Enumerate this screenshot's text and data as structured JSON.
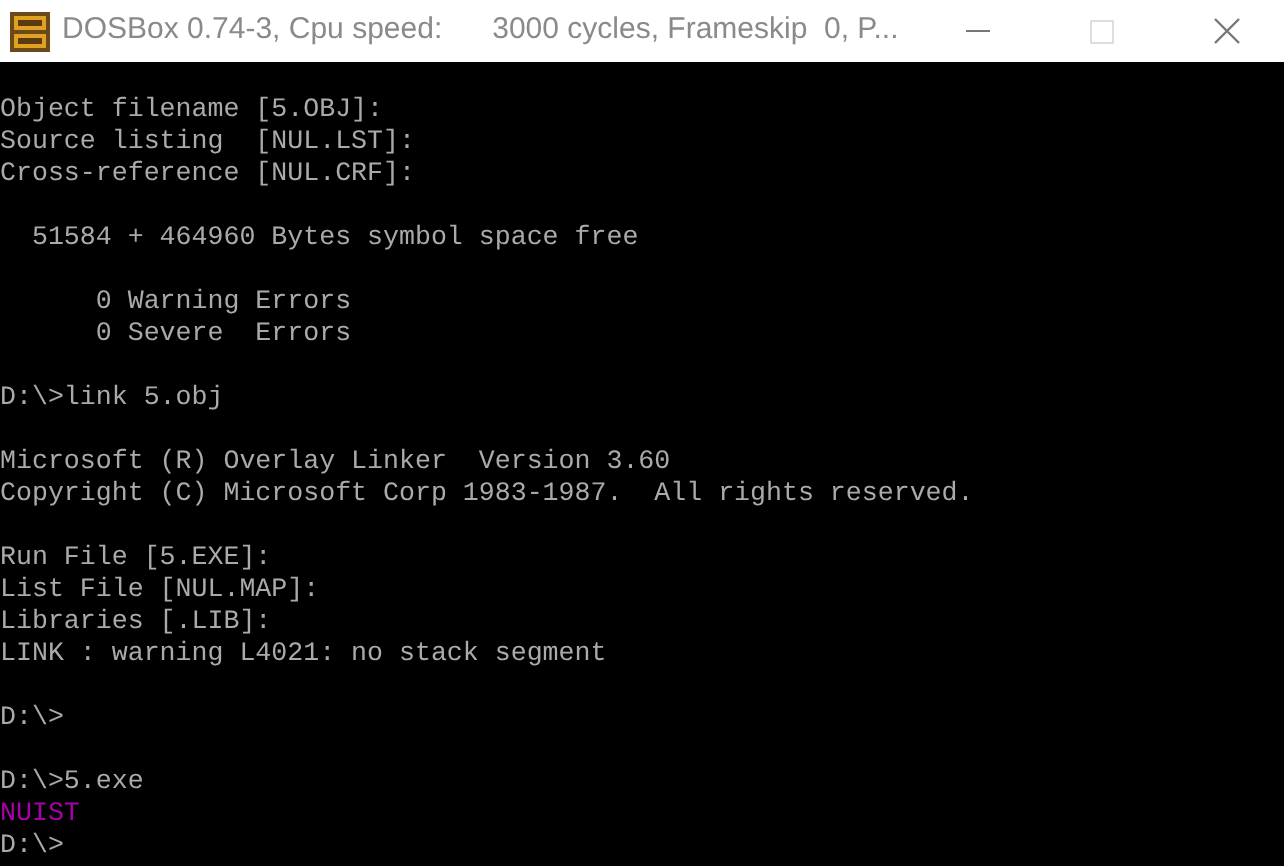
{
  "window": {
    "title": "DOSBox 0.74-3, Cpu speed:      3000 cycles, Frameskip  0, P..."
  },
  "console": {
    "blocks": [
      [
        {
          "text": "Object filename [5.OBJ]:",
          "color": "#aaaaaa"
        },
        {
          "text": "Source listing  [NUL.LST]:",
          "color": "#aaaaaa"
        },
        {
          "text": "Cross-reference [NUL.CRF]:",
          "color": "#aaaaaa"
        }
      ],
      [
        {
          "text": "  51584 + 464960 Bytes symbol space free",
          "color": "#aaaaaa"
        }
      ],
      [
        {
          "text": "      0 Warning Errors",
          "color": "#aaaaaa"
        },
        {
          "text": "      0 Severe  Errors",
          "color": "#aaaaaa"
        }
      ],
      [
        {
          "text": "D:\\>link 5.obj",
          "color": "#aaaaaa"
        }
      ],
      [
        {
          "text": "Microsoft (R) Overlay Linker  Version 3.60",
          "color": "#aaaaaa"
        },
        {
          "text": "Copyright (C) Microsoft Corp 1983-1987.  All rights reserved.",
          "color": "#aaaaaa"
        }
      ],
      [
        {
          "text": "Run File [5.EXE]:",
          "color": "#aaaaaa"
        },
        {
          "text": "List File [NUL.MAP]:",
          "color": "#aaaaaa"
        },
        {
          "text": "Libraries [.LIB]:",
          "color": "#aaaaaa"
        },
        {
          "text": "LINK : warning L4021: no stack segment",
          "color": "#aaaaaa"
        }
      ],
      [
        {
          "text": "D:\\>",
          "color": "#aaaaaa"
        }
      ],
      [
        {
          "text": "D:\\>5.exe",
          "color": "#aaaaaa"
        },
        {
          "text": "NUIST",
          "color": "#aa00aa"
        },
        {
          "text": "D:\\>",
          "color": "#aaaaaa"
        }
      ]
    ]
  }
}
